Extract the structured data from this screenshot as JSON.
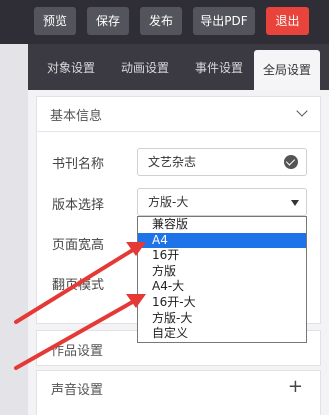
{
  "toolbar": {
    "preview_label": "预览",
    "save_label": "保存",
    "publish_label": "发布",
    "export_pdf_label": "导出PDF",
    "exit_label": "退出"
  },
  "tabs": [
    "对象设置",
    "动画设置",
    "事件设置",
    "全局设置"
  ],
  "basic_info": {
    "title": "基本信息",
    "journal_name_label": "书刊名称",
    "journal_name_value": "文艺杂志",
    "edition_label": "版本选择",
    "edition_value": "方版-大",
    "page_size_label": "页面宽高",
    "flip_mode_label": "翻页模式"
  },
  "edition_options": [
    "兼容版",
    "A4",
    "16开",
    "方版",
    "A4-大",
    "16开-大",
    "方版-大",
    "自定义"
  ],
  "edition_highlighted": "A4",
  "works_settings_title": "作品设置",
  "sound_settings_title": "声音设置",
  "colors": {
    "exit_red": "#e8443c",
    "toolbar_dark": "#2f2e36",
    "highlight_blue": "#1e73e8",
    "arrow_red": "#e53935"
  }
}
